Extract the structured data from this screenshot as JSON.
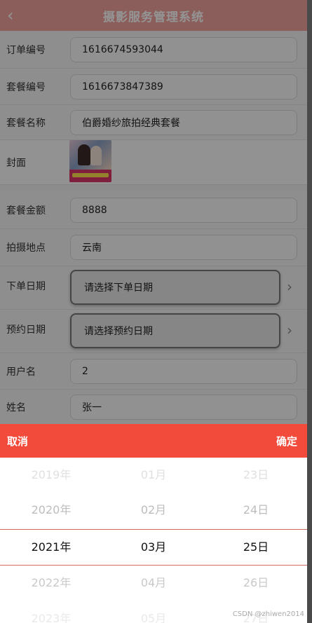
{
  "header": {
    "title": "摄影服务管理系统",
    "back_icon": "chevron-left-icon"
  },
  "form": {
    "order_no": {
      "label": "订单编号",
      "value": "1616674593044"
    },
    "package_no": {
      "label": "套餐编号",
      "value": "1616673847389"
    },
    "package_name": {
      "label": "套餐名称",
      "value": "伯爵婚纱旅拍经典套餐"
    },
    "cover": {
      "label": "封面"
    },
    "amount": {
      "label": "套餐金额",
      "value": "8888"
    },
    "location": {
      "label": "拍摄地点",
      "value": "云南"
    },
    "order_date": {
      "label": "下单日期",
      "placeholder": "请选择下单日期"
    },
    "appointment_date": {
      "label": "预约日期",
      "placeholder": "请选择预约日期"
    },
    "username": {
      "label": "用户名",
      "value": "2"
    },
    "name": {
      "label": "姓名",
      "value": "张一"
    }
  },
  "picker": {
    "cancel": "取消",
    "confirm": "确定",
    "years": [
      "2019年",
      "2020年",
      "2021年",
      "2022年",
      "2023年"
    ],
    "months": [
      "01月",
      "02月",
      "03月",
      "04月",
      "05月"
    ],
    "days": [
      "23日",
      "24日",
      "25日",
      "26日",
      "27日"
    ]
  },
  "watermark": "CSDN @zhiwen2014",
  "colors": {
    "header": "#f0a39d",
    "accent": "#f24a3b"
  }
}
